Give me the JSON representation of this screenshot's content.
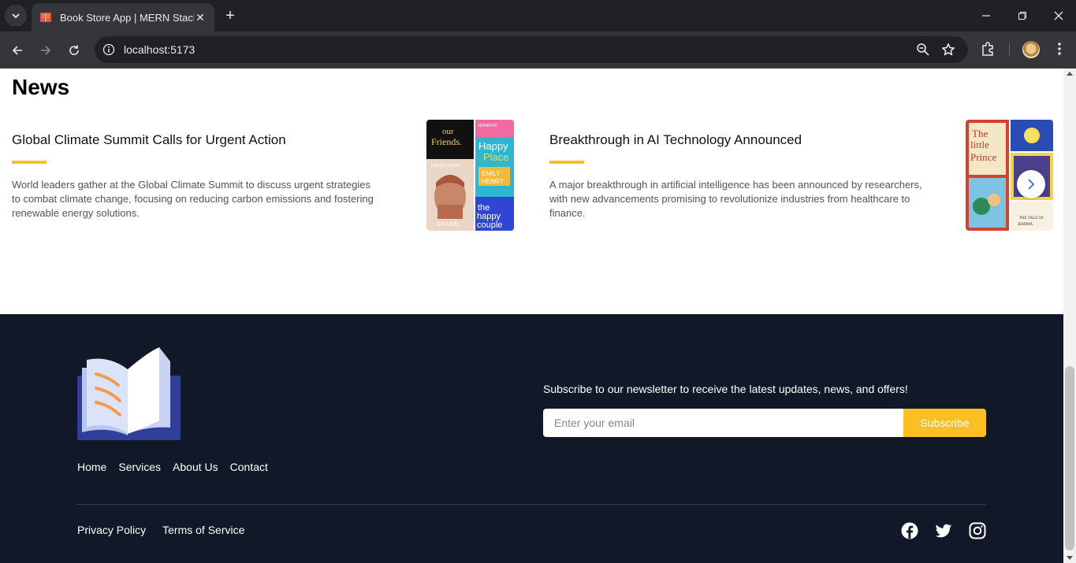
{
  "browser": {
    "tab_title": "Book Store App | MERN Stack P",
    "url": "localhost:5173",
    "colors": {
      "tabbar": "#202124",
      "toolbar": "#35363a"
    }
  },
  "news": {
    "heading": "News",
    "articles": [
      {
        "title": "Global Climate Summit Calls for Urgent Action",
        "description": "World leaders gather at the Global Climate Summit to discuss urgent strategies to combat climate change, focusing on reducing carbon emissions and fostering renewable energy solutions.",
        "image": "book-covers-collage"
      },
      {
        "title": "Breakthrough in AI Technology Announced",
        "description": "A major breakthrough in artificial intelligence has been announced by researchers, with new advancements promising to revolutionize industries from healthcare to finance.",
        "image": "childrens-book-covers"
      }
    ],
    "accent_color": "#fbbf24"
  },
  "footer": {
    "nav": [
      "Home",
      "Services",
      "About Us",
      "Contact"
    ],
    "subscribe_text": "Subscribe to our newsletter to receive the latest updates, news, and offers!",
    "email_placeholder": "Enter your email",
    "subscribe_label": "Subscribe",
    "legal": [
      "Privacy Policy",
      "Terms of Service"
    ],
    "social": [
      "facebook-icon",
      "twitter-icon",
      "instagram-icon"
    ],
    "colors": {
      "background": "#111827",
      "button": "#fbbf24"
    }
  }
}
